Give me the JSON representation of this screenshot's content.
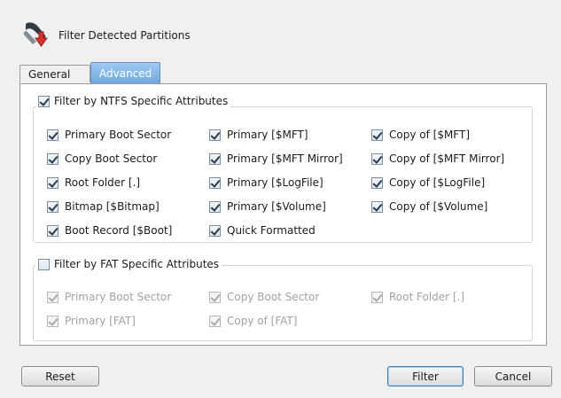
{
  "window": {
    "title": "Filter Detected Partitions"
  },
  "tabs": [
    {
      "label": "General",
      "active": false
    },
    {
      "label": "Advanced",
      "active": true
    }
  ],
  "ntfs": {
    "title": "Filter by NTFS Specific Attributes",
    "checked": true,
    "items": [
      {
        "label": "Primary Boot Sector",
        "checked": true
      },
      {
        "label": "Copy Boot Sector",
        "checked": true
      },
      {
        "label": "Root Folder [.]",
        "checked": true
      },
      {
        "label": "Bitmap [$Bitmap]",
        "checked": true
      },
      {
        "label": "Boot Record [$Boot]",
        "checked": true
      },
      {
        "label": "Primary [$MFT]",
        "checked": true
      },
      {
        "label": "Primary [$MFT Mirror]",
        "checked": true
      },
      {
        "label": "Primary [$LogFile]",
        "checked": true
      },
      {
        "label": "Primary [$Volume]",
        "checked": true
      },
      {
        "label": "Quick Formatted",
        "checked": true
      },
      {
        "label": "Copy of [$MFT]",
        "checked": true
      },
      {
        "label": "Copy of [$MFT Mirror]",
        "checked": true
      },
      {
        "label": "Copy of [$LogFile]",
        "checked": true
      },
      {
        "label": "Copy of [$Volume]",
        "checked": true
      }
    ]
  },
  "fat": {
    "title": "Filter by FAT Specific Attributes",
    "checked": false,
    "items": [
      {
        "label": "Primary Boot Sector",
        "checked": true,
        "disabled": true
      },
      {
        "label": "Primary [FAT]",
        "checked": true,
        "disabled": true
      },
      {
        "label": "Copy Boot Sector",
        "checked": true,
        "disabled": true
      },
      {
        "label": "Copy of [FAT]",
        "checked": true,
        "disabled": true
      },
      {
        "label": "Root Folder [.]",
        "checked": true,
        "disabled": true
      }
    ]
  },
  "buttons": {
    "reset": "Reset",
    "filter": "Filter",
    "cancel": "Cancel"
  },
  "colors": {
    "active_tab": "#7fb4e6",
    "panel_bg": "#ffffff",
    "window_bg": "#f0f0f0",
    "disabled_text": "#a2a2a2"
  }
}
